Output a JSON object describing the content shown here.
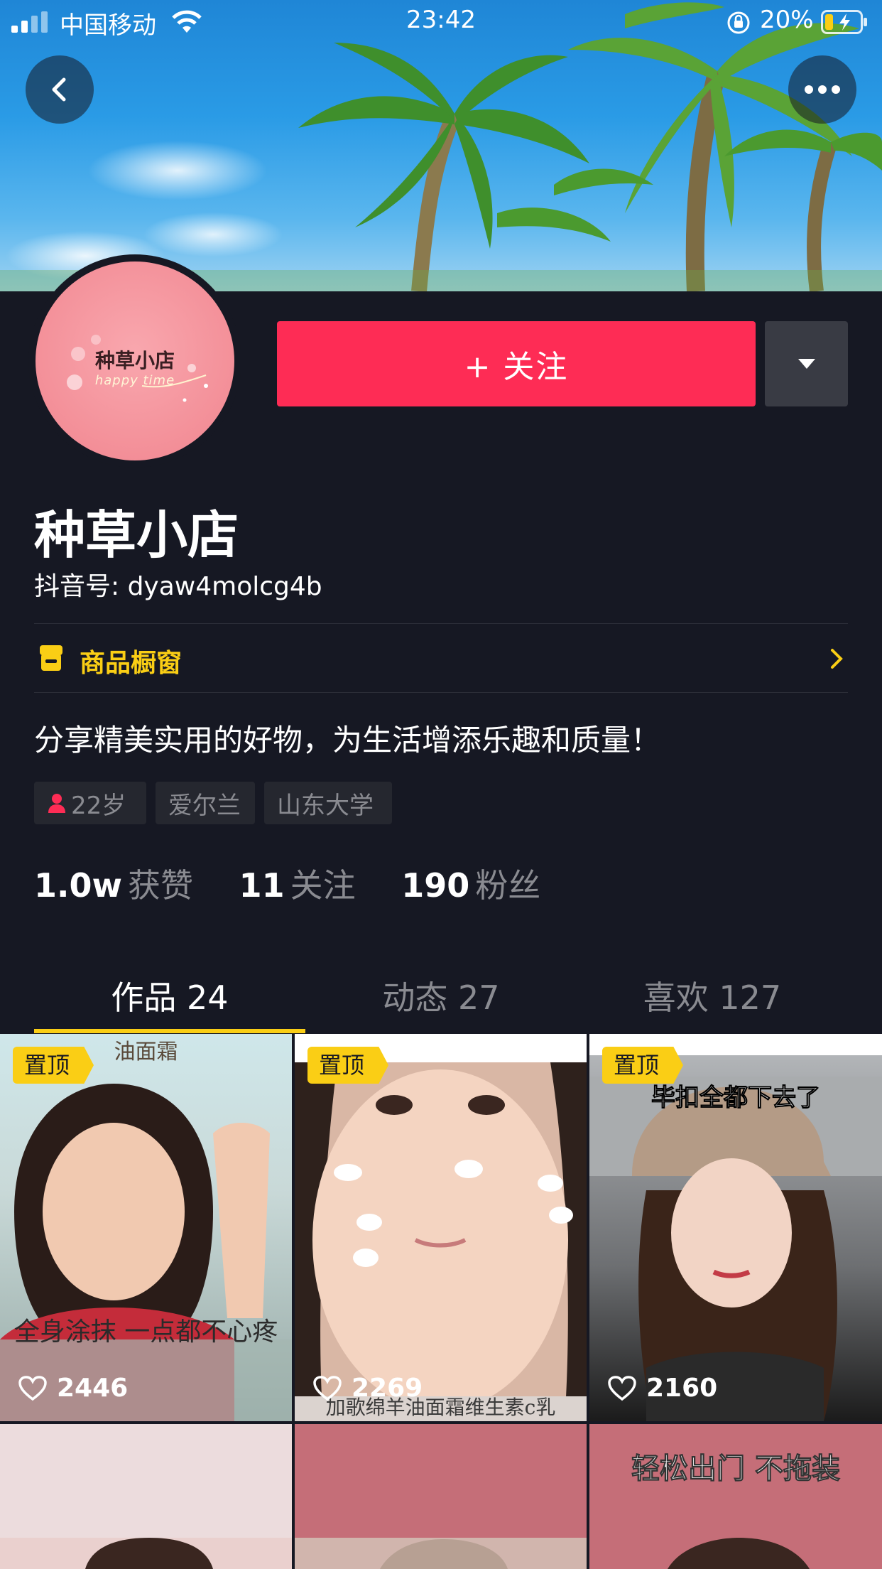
{
  "status_bar": {
    "carrier": "中国移动",
    "time": "23:42",
    "battery": "20%"
  },
  "profile": {
    "avatar_text": "种草小店",
    "avatar_subtext": "happy time",
    "name": "种草小店",
    "douyin_id": "抖音号: dyaw4molcg4b",
    "follow_label": "+ 关注",
    "shop_window_label": "商品橱窗",
    "bio": "分享精美实用的好物，为生活增添乐趣和质量！",
    "tags": [
      "22岁",
      "爱尔兰",
      "山东大学"
    ]
  },
  "stats": [
    {
      "value": "1.0w",
      "label": "获赞"
    },
    {
      "value": "11",
      "label": "关注"
    },
    {
      "value": "190",
      "label": "粉丝"
    }
  ],
  "tabs": [
    {
      "label": "作品 24",
      "active": true
    },
    {
      "label": "动态 27",
      "active": false
    },
    {
      "label": "喜欢 127",
      "active": false
    }
  ],
  "videos": [
    {
      "pinned": "置顶",
      "likes": "2446",
      "caption": "全身涂抹 一点都不心疼",
      "top_caption": "油面霜"
    },
    {
      "pinned": "置顶",
      "likes": "2269",
      "caption": "加歌绵羊油面霜维生素c乳",
      "top_caption": ""
    },
    {
      "pinned": "置顶",
      "likes": "2160",
      "caption": "",
      "top_caption": "毕扣全都下去了"
    },
    {
      "pinned": "",
      "likes": "",
      "caption": "",
      "top_caption": ""
    },
    {
      "pinned": "",
      "likes": "",
      "caption": "",
      "top_caption": ""
    },
    {
      "pinned": "",
      "likes": "",
      "caption": "",
      "top_caption": "轻松出门 不拖装"
    }
  ],
  "colors": {
    "background": "#161823",
    "follow": "#fe2c55",
    "accent_yellow": "#face15",
    "muted_text": "#8a8b91"
  },
  "icons": [
    "signal-icon",
    "wifi-icon",
    "rotation-lock-icon",
    "battery-icon",
    "back-icon",
    "more-icon",
    "caret-down-icon",
    "shop-icon",
    "chevron-right-icon",
    "female-icon",
    "heart-icon"
  ]
}
